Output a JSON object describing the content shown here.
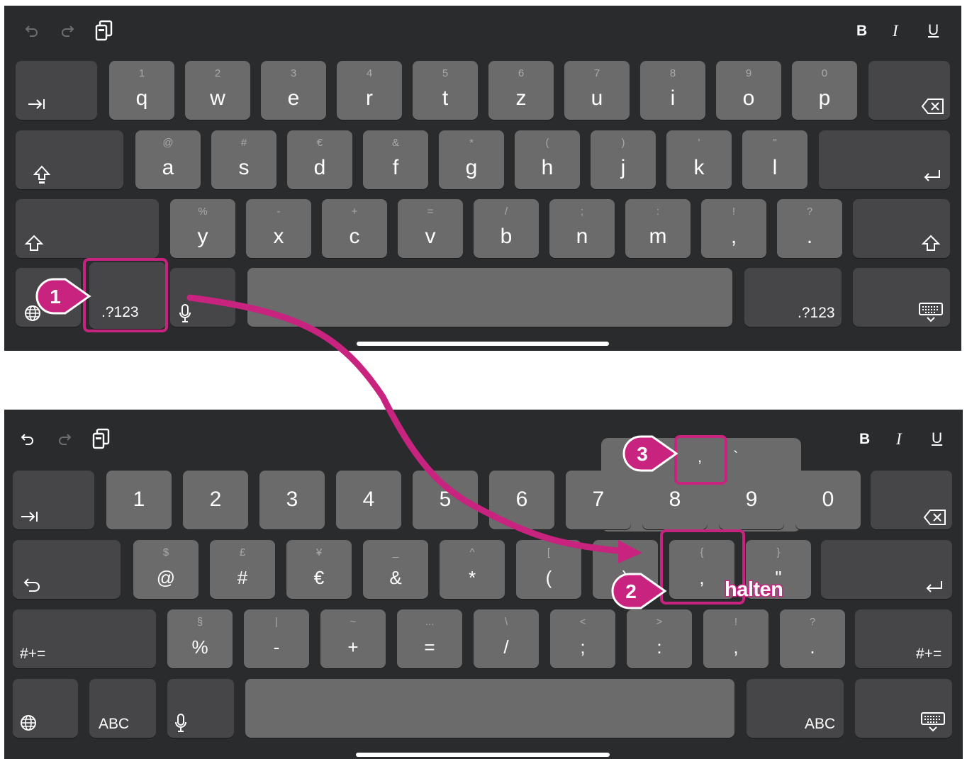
{
  "colors": {
    "keyboard_bg": "#2a2b2d",
    "key": "#6b6b6b",
    "key_dark": "#464648",
    "annotation": "#c8237f"
  },
  "toolbar": {
    "icons": [
      "undo-icon",
      "redo-icon",
      "paste-icon"
    ],
    "bold": "B",
    "italic": "I",
    "underline": "U"
  },
  "kb1": {
    "row1": [
      {
        "h": "1",
        "m": "q"
      },
      {
        "h": "2",
        "m": "w"
      },
      {
        "h": "3",
        "m": "e"
      },
      {
        "h": "4",
        "m": "r"
      },
      {
        "h": "5",
        "m": "t"
      },
      {
        "h": "6",
        "m": "z"
      },
      {
        "h": "7",
        "m": "u"
      },
      {
        "h": "8",
        "m": "i"
      },
      {
        "h": "9",
        "m": "o"
      },
      {
        "h": "0",
        "m": "p"
      }
    ],
    "row2": [
      {
        "h": "@",
        "m": "a"
      },
      {
        "h": "#",
        "m": "s"
      },
      {
        "h": "€",
        "m": "d"
      },
      {
        "h": "&",
        "m": "f"
      },
      {
        "h": "*",
        "m": "g"
      },
      {
        "h": "(",
        "m": "h"
      },
      {
        "h": ")",
        "m": "j"
      },
      {
        "h": "'",
        "m": "k"
      },
      {
        "h": "\"",
        "m": "l"
      }
    ],
    "row3": [
      {
        "h": "%",
        "m": "y"
      },
      {
        "h": "-",
        "m": "x"
      },
      {
        "h": "+",
        "m": "c"
      },
      {
        "h": "=",
        "m": "v"
      },
      {
        "h": "/",
        "m": "b"
      },
      {
        "h": ";",
        "m": "n"
      },
      {
        "h": ":",
        "m": "m"
      },
      {
        "h": "!",
        "m": ","
      },
      {
        "h": "?",
        "m": "."
      }
    ],
    "numbers_key": ".?123",
    "numbers_key_right": ".?123"
  },
  "kb2": {
    "row1": [
      "1",
      "2",
      "3",
      "4",
      "5",
      "6",
      "7",
      "8",
      "9",
      "0"
    ],
    "row2": [
      {
        "h": "$",
        "m": "@"
      },
      {
        "h": "£",
        "m": "#"
      },
      {
        "h": "¥",
        "m": "€"
      },
      {
        "h": "_",
        "m": "&"
      },
      {
        "h": "^",
        "m": "*"
      },
      {
        "h": "[",
        "m": "("
      },
      {
        "h": "]",
        "m": ")"
      },
      {
        "h": "{",
        "m": ","
      },
      {
        "h": "}",
        "m": "\""
      }
    ],
    "row3": [
      {
        "h": "§",
        "m": "%"
      },
      {
        "h": "|",
        "m": "-"
      },
      {
        "h": "~",
        "m": "+"
      },
      {
        "h": "...",
        "m": "="
      },
      {
        "h": "\\",
        "m": "/"
      },
      {
        "h": "<",
        "m": ";"
      },
      {
        "h": ">",
        "m": ":"
      },
      {
        "h": "!",
        "m": ","
      },
      {
        "h": "?",
        "m": "."
      }
    ],
    "symbols_key": "#+=",
    "symbols_key_right": "#+=",
    "abc_key": "ABC",
    "abc_key_right": "ABC",
    "popup": {
      "top": [
        ",",
        "`"
      ],
      "bottom": [
        ",",
        "‹",
        ",",
        ",",
        "›"
      ]
    }
  },
  "annotations": {
    "step1": "1",
    "step2": "2",
    "step3": "3",
    "hold_label": "halten"
  }
}
